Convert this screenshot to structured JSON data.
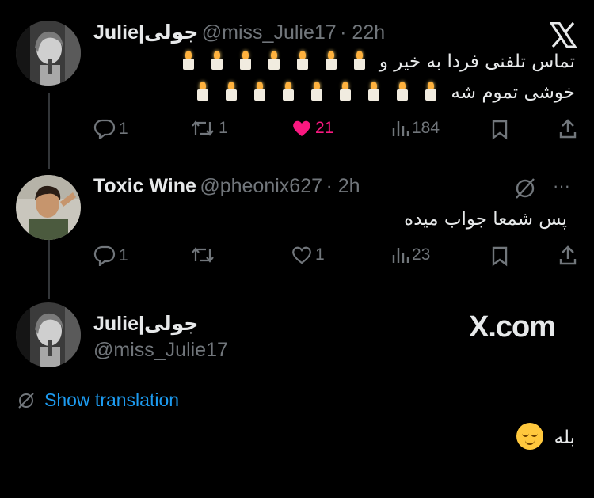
{
  "tweet1": {
    "name": "Julie|جولی",
    "handle": "@miss_Julie17",
    "time": "· 22h",
    "text_line1": "تماس تلفنی فردا به خیر و",
    "text_line2": "خوشی تموم شه",
    "candles_line1": 7,
    "candles_line2": 9,
    "replies": "1",
    "retweets": "1",
    "likes": "21",
    "views": "184",
    "like_color": "#f91880"
  },
  "tweet2": {
    "name": "Toxic Wine",
    "handle": "@pheonix627",
    "time": "· 2h",
    "text": "پس شمعا جواب میده",
    "replies": "1",
    "retweets": "",
    "likes": "1",
    "views": "23",
    "more": "···"
  },
  "tweet3": {
    "name": "Julie|جولی",
    "handle": "@miss_Julie17",
    "translation_label": "Show translation",
    "text": "بله"
  },
  "brand": {
    "site": "X.com",
    "logo": "x-logo-icon"
  },
  "colors": {
    "background": "#000000",
    "text": "#e7e9ea",
    "secondary": "#71767b",
    "link": "#1d9bf0"
  }
}
